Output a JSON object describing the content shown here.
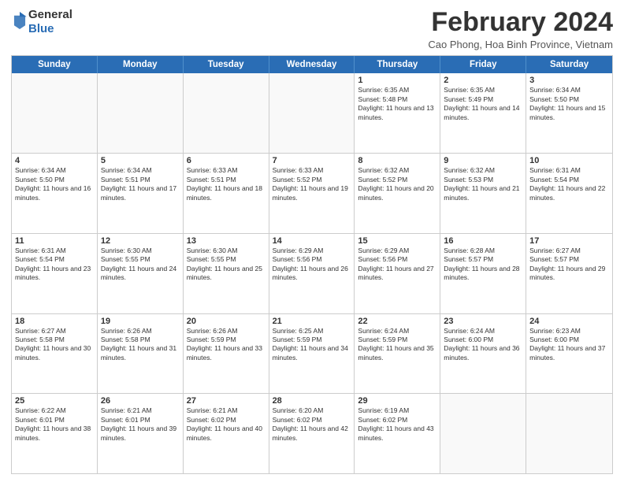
{
  "header": {
    "logo_general": "General",
    "logo_blue": "Blue",
    "month_year": "February 2024",
    "location": "Cao Phong, Hoa Binh Province, Vietnam"
  },
  "days_of_week": [
    "Sunday",
    "Monday",
    "Tuesday",
    "Wednesday",
    "Thursday",
    "Friday",
    "Saturday"
  ],
  "weeks": [
    [
      {
        "num": "",
        "info": ""
      },
      {
        "num": "",
        "info": ""
      },
      {
        "num": "",
        "info": ""
      },
      {
        "num": "",
        "info": ""
      },
      {
        "num": "1",
        "info": "Sunrise: 6:35 AM\nSunset: 5:48 PM\nDaylight: 11 hours and 13 minutes."
      },
      {
        "num": "2",
        "info": "Sunrise: 6:35 AM\nSunset: 5:49 PM\nDaylight: 11 hours and 14 minutes."
      },
      {
        "num": "3",
        "info": "Sunrise: 6:34 AM\nSunset: 5:50 PM\nDaylight: 11 hours and 15 minutes."
      }
    ],
    [
      {
        "num": "4",
        "info": "Sunrise: 6:34 AM\nSunset: 5:50 PM\nDaylight: 11 hours and 16 minutes."
      },
      {
        "num": "5",
        "info": "Sunrise: 6:34 AM\nSunset: 5:51 PM\nDaylight: 11 hours and 17 minutes."
      },
      {
        "num": "6",
        "info": "Sunrise: 6:33 AM\nSunset: 5:51 PM\nDaylight: 11 hours and 18 minutes."
      },
      {
        "num": "7",
        "info": "Sunrise: 6:33 AM\nSunset: 5:52 PM\nDaylight: 11 hours and 19 minutes."
      },
      {
        "num": "8",
        "info": "Sunrise: 6:32 AM\nSunset: 5:52 PM\nDaylight: 11 hours and 20 minutes."
      },
      {
        "num": "9",
        "info": "Sunrise: 6:32 AM\nSunset: 5:53 PM\nDaylight: 11 hours and 21 minutes."
      },
      {
        "num": "10",
        "info": "Sunrise: 6:31 AM\nSunset: 5:54 PM\nDaylight: 11 hours and 22 minutes."
      }
    ],
    [
      {
        "num": "11",
        "info": "Sunrise: 6:31 AM\nSunset: 5:54 PM\nDaylight: 11 hours and 23 minutes."
      },
      {
        "num": "12",
        "info": "Sunrise: 6:30 AM\nSunset: 5:55 PM\nDaylight: 11 hours and 24 minutes."
      },
      {
        "num": "13",
        "info": "Sunrise: 6:30 AM\nSunset: 5:55 PM\nDaylight: 11 hours and 25 minutes."
      },
      {
        "num": "14",
        "info": "Sunrise: 6:29 AM\nSunset: 5:56 PM\nDaylight: 11 hours and 26 minutes."
      },
      {
        "num": "15",
        "info": "Sunrise: 6:29 AM\nSunset: 5:56 PM\nDaylight: 11 hours and 27 minutes."
      },
      {
        "num": "16",
        "info": "Sunrise: 6:28 AM\nSunset: 5:57 PM\nDaylight: 11 hours and 28 minutes."
      },
      {
        "num": "17",
        "info": "Sunrise: 6:27 AM\nSunset: 5:57 PM\nDaylight: 11 hours and 29 minutes."
      }
    ],
    [
      {
        "num": "18",
        "info": "Sunrise: 6:27 AM\nSunset: 5:58 PM\nDaylight: 11 hours and 30 minutes."
      },
      {
        "num": "19",
        "info": "Sunrise: 6:26 AM\nSunset: 5:58 PM\nDaylight: 11 hours and 31 minutes."
      },
      {
        "num": "20",
        "info": "Sunrise: 6:26 AM\nSunset: 5:59 PM\nDaylight: 11 hours and 33 minutes."
      },
      {
        "num": "21",
        "info": "Sunrise: 6:25 AM\nSunset: 5:59 PM\nDaylight: 11 hours and 34 minutes."
      },
      {
        "num": "22",
        "info": "Sunrise: 6:24 AM\nSunset: 5:59 PM\nDaylight: 11 hours and 35 minutes."
      },
      {
        "num": "23",
        "info": "Sunrise: 6:24 AM\nSunset: 6:00 PM\nDaylight: 11 hours and 36 minutes."
      },
      {
        "num": "24",
        "info": "Sunrise: 6:23 AM\nSunset: 6:00 PM\nDaylight: 11 hours and 37 minutes."
      }
    ],
    [
      {
        "num": "25",
        "info": "Sunrise: 6:22 AM\nSunset: 6:01 PM\nDaylight: 11 hours and 38 minutes."
      },
      {
        "num": "26",
        "info": "Sunrise: 6:21 AM\nSunset: 6:01 PM\nDaylight: 11 hours and 39 minutes."
      },
      {
        "num": "27",
        "info": "Sunrise: 6:21 AM\nSunset: 6:02 PM\nDaylight: 11 hours and 40 minutes."
      },
      {
        "num": "28",
        "info": "Sunrise: 6:20 AM\nSunset: 6:02 PM\nDaylight: 11 hours and 42 minutes."
      },
      {
        "num": "29",
        "info": "Sunrise: 6:19 AM\nSunset: 6:02 PM\nDaylight: 11 hours and 43 minutes."
      },
      {
        "num": "",
        "info": ""
      },
      {
        "num": "",
        "info": ""
      }
    ]
  ]
}
